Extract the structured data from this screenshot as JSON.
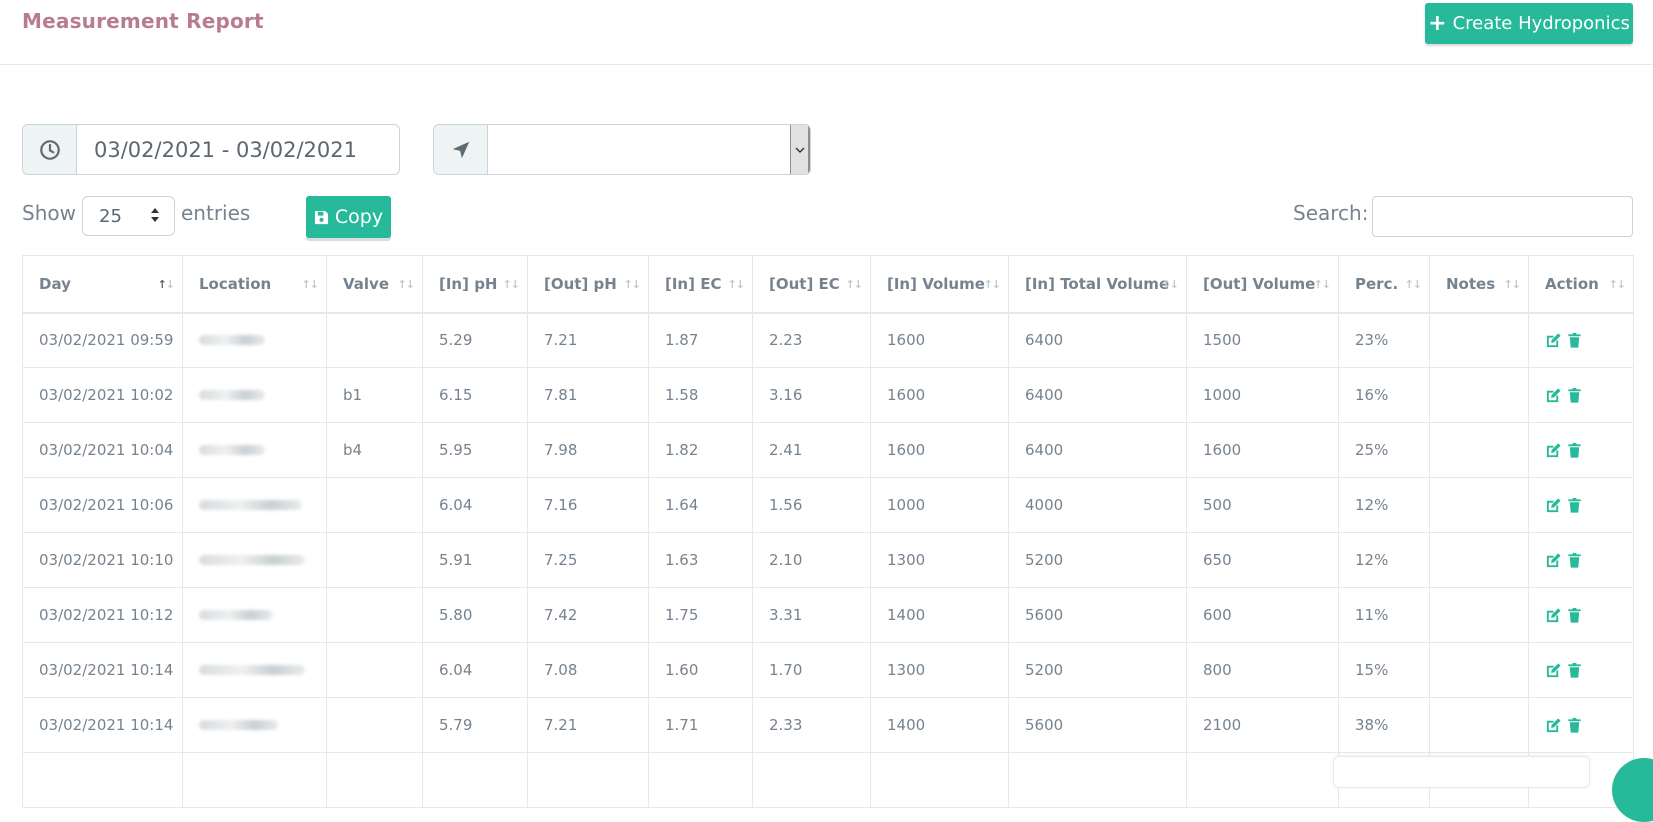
{
  "header": {
    "title": "Measurement Report",
    "create_button": "Create Hydroponics"
  },
  "filters": {
    "date_range": "03/02/2021 - 03/02/2021",
    "location_value": ""
  },
  "controls": {
    "show_label": "Show",
    "entries_value": "25",
    "entries_label": "entries",
    "copy_label": "Copy",
    "search_label": "Search:",
    "search_value": ""
  },
  "table": {
    "columns": [
      "Day",
      "Location",
      "Valve",
      "[In] pH",
      "[Out] pH",
      "[In] EC",
      "[Out] EC",
      "[In] Volume",
      "[In] Total Volume",
      "[Out] Volume",
      "Perc.",
      "Notes",
      "Action"
    ],
    "rows": [
      {
        "day": "03/02/2021 09:59",
        "valve": "",
        "in_ph": "5.29",
        "out_ph": "7.21",
        "in_ec": "1.87",
        "out_ec": "2.23",
        "in_volume": "1600",
        "in_total_volume": "6400",
        "out_volume": "1500",
        "perc": "23%",
        "notes": ""
      },
      {
        "day": "03/02/2021 10:02",
        "valve": "b1",
        "in_ph": "6.15",
        "out_ph": "7.81",
        "in_ec": "1.58",
        "out_ec": "3.16",
        "in_volume": "1600",
        "in_total_volume": "6400",
        "out_volume": "1000",
        "perc": "16%",
        "notes": ""
      },
      {
        "day": "03/02/2021 10:04",
        "valve": "b4",
        "in_ph": "5.95",
        "out_ph": "7.98",
        "in_ec": "1.82",
        "out_ec": "2.41",
        "in_volume": "1600",
        "in_total_volume": "6400",
        "out_volume": "1600",
        "perc": "25%",
        "notes": ""
      },
      {
        "day": "03/02/2021 10:06",
        "valve": "",
        "in_ph": "6.04",
        "out_ph": "7.16",
        "in_ec": "1.64",
        "out_ec": "1.56",
        "in_volume": "1000",
        "in_total_volume": "4000",
        "out_volume": "500",
        "perc": "12%",
        "notes": ""
      },
      {
        "day": "03/02/2021 10:10",
        "valve": "",
        "in_ph": "5.91",
        "out_ph": "7.25",
        "in_ec": "1.63",
        "out_ec": "2.10",
        "in_volume": "1300",
        "in_total_volume": "5200",
        "out_volume": "650",
        "perc": "12%",
        "notes": ""
      },
      {
        "day": "03/02/2021 10:12",
        "valve": "",
        "in_ph": "5.80",
        "out_ph": "7.42",
        "in_ec": "1.75",
        "out_ec": "3.31",
        "in_volume": "1400",
        "in_total_volume": "5600",
        "out_volume": "600",
        "perc": "11%",
        "notes": ""
      },
      {
        "day": "03/02/2021 10:14",
        "valve": "",
        "in_ph": "6.04",
        "out_ph": "7.08",
        "in_ec": "1.60",
        "out_ec": "1.70",
        "in_volume": "1300",
        "in_total_volume": "5200",
        "out_volume": "800",
        "perc": "15%",
        "notes": ""
      },
      {
        "day": "03/02/2021 10:14",
        "valve": "",
        "in_ph": "5.79",
        "out_ph": "7.21",
        "in_ec": "1.71",
        "out_ec": "2.33",
        "in_volume": "1400",
        "in_total_volume": "5600",
        "out_volume": "2100",
        "perc": "38%",
        "notes": ""
      },
      {
        "day": "",
        "valve": "",
        "in_ph": "",
        "out_ph": "",
        "in_ec": "",
        "out_ec": "",
        "in_volume": "",
        "in_total_volume": "",
        "out_volume": "",
        "perc": "",
        "notes": ""
      }
    ]
  },
  "icons": {
    "create": "plus-icon",
    "date": "clock-icon",
    "location": "location-arrow-icon",
    "copy": "floppy-disk-icon",
    "edit": "edit-icon",
    "delete": "trash-icon"
  },
  "colors": {
    "accent": "#26b99a",
    "title": "#b77d8f",
    "text": "#76838f",
    "border": "#e4eaec"
  }
}
